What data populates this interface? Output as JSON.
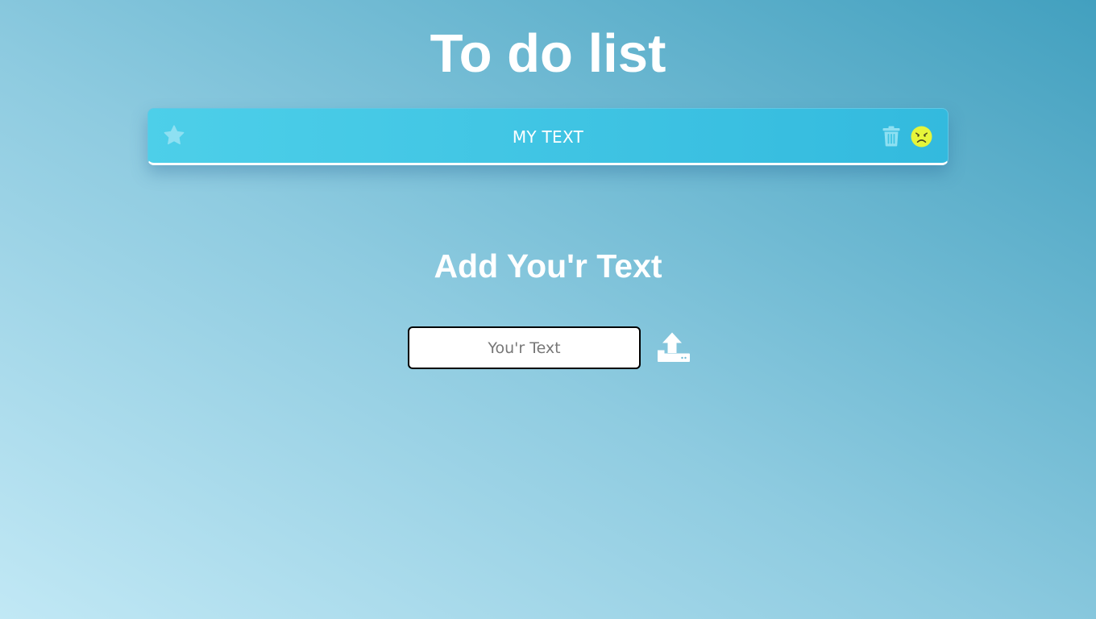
{
  "header": {
    "title": "To do list"
  },
  "todo_items": [
    {
      "text": "MY TEXT",
      "icons": [
        "star-icon",
        "trash-icon",
        "sad-face-icon"
      ]
    }
  ],
  "add_section": {
    "title": "Add You'r Text",
    "input_placeholder": "You'r Text",
    "input_value": "",
    "submit_icon": "upload-icon"
  },
  "colors": {
    "item_background": "#40c4e3",
    "star": "#8ee0f2",
    "trash": "#8ee0f2",
    "sad_face": "#e6f53a",
    "text": "#ffffff"
  }
}
